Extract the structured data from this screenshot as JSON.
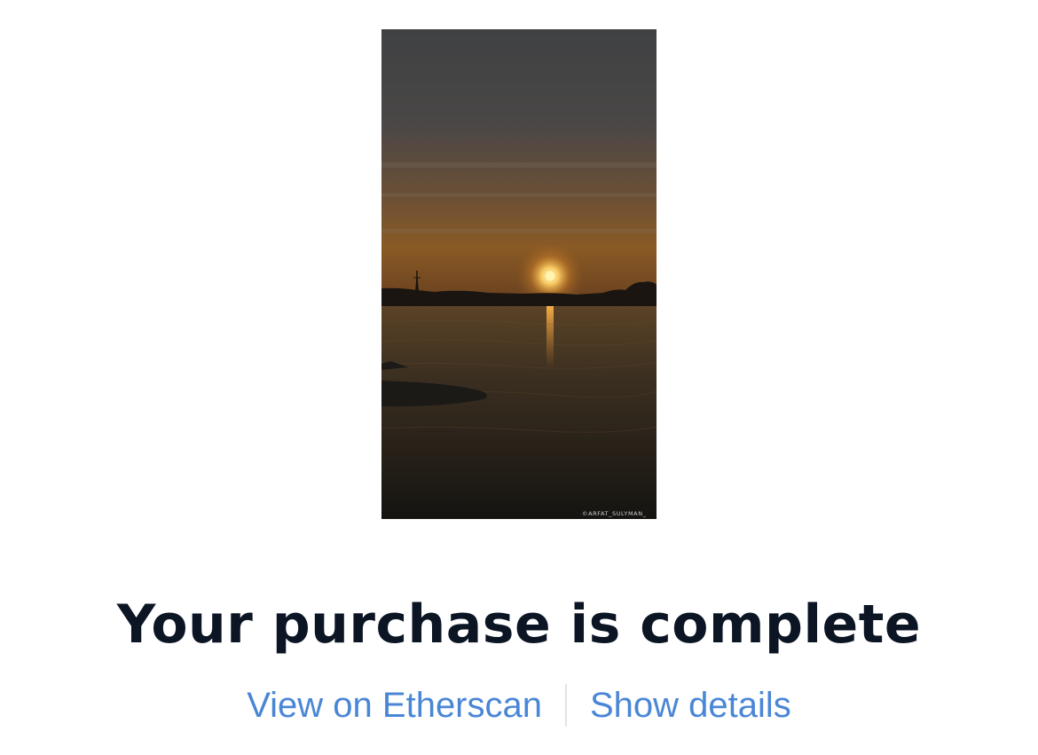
{
  "artwork": {
    "watermark": "©ARFAT_SULYMAN_"
  },
  "headline": "Your purchase is complete",
  "actions": {
    "etherscan_label": "View on Etherscan",
    "details_label": "Show details"
  },
  "colors": {
    "headline": "#0c1524",
    "link": "#4a86d6",
    "divider": "#e2e4e8"
  }
}
